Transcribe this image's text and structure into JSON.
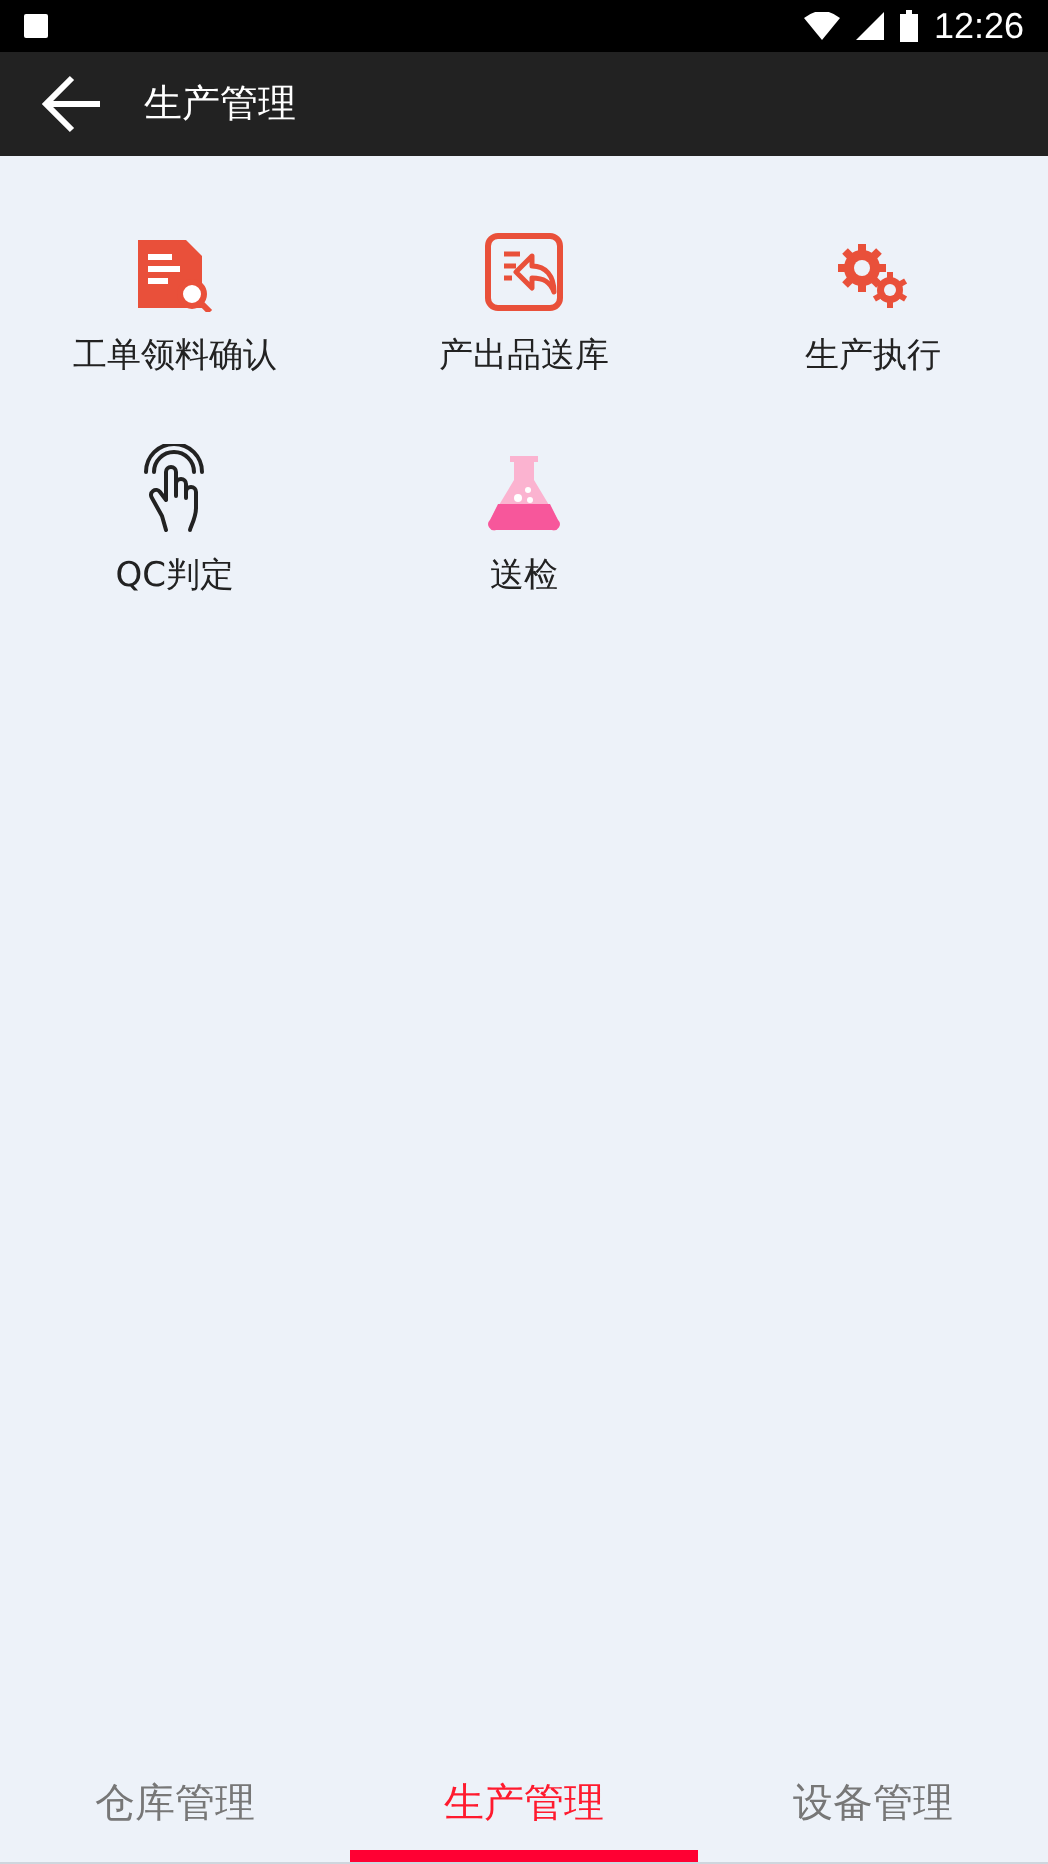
{
  "status_bar": {
    "time": "12:26"
  },
  "app_bar": {
    "title": "生产管理"
  },
  "items": [
    {
      "kind": "document-search",
      "label": "工单领料确认"
    },
    {
      "kind": "return",
      "label": "产出品送库"
    },
    {
      "kind": "gears",
      "label": "生产执行"
    },
    {
      "kind": "touch",
      "label": "QC判定"
    },
    {
      "kind": "flask",
      "label": "送检"
    }
  ],
  "tabs": [
    {
      "label": "仓库管理",
      "selected": false
    },
    {
      "label": "生产管理",
      "selected": true
    },
    {
      "label": "设备管理",
      "selected": false
    }
  ]
}
